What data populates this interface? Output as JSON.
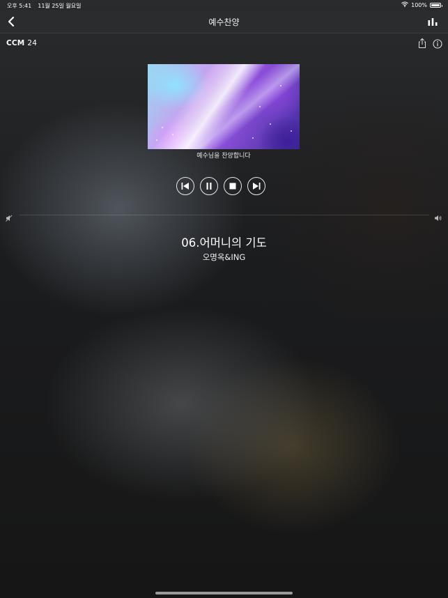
{
  "status_bar": {
    "time": "오후 5:41",
    "date": "11월 25일 월요일",
    "battery_text": "100%"
  },
  "nav": {
    "title": "예수찬양",
    "back_icon": "chevron-left-icon",
    "right_icon": "bar-chart-icon"
  },
  "brand": {
    "logo_main": "CCM",
    "logo_num": "24"
  },
  "toolbar_icons": [
    "share-icon",
    "info-icon"
  ],
  "album": {
    "caption": "예수님을 찬양합니다"
  },
  "controls": [
    "previous-icon",
    "pause-icon",
    "stop-icon",
    "next-icon"
  ],
  "track": {
    "title": "06.어머니의 기도",
    "artist": "오명옥&ING"
  },
  "colors": {
    "accent": "#ffffff",
    "nav_background": "#2b2c2e"
  }
}
